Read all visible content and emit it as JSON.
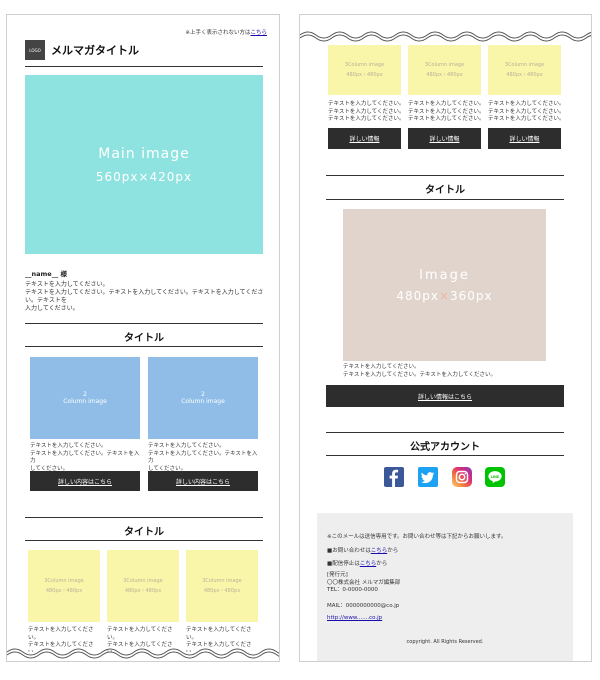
{
  "header": {
    "preheader_text": "※上手く表示されない方は",
    "preheader_link": "こちら",
    "logo": "LOGO",
    "title": "メルマガタイトル"
  },
  "main_image": {
    "label": "Main image",
    "size": "560px × 420px",
    "size_num1": "560px",
    "size_x": "×",
    "size_num2": "420px",
    "color": "#8ee3e0"
  },
  "greeting": {
    "name": "__name__ 様"
  },
  "intro_lines": [
    "テキストを入力してください。",
    "テキストを入力してください。テキストを入力してください。テキストを入力してください。テキストを",
    "入力してください。"
  ],
  "section2": {
    "title": "タイトル",
    "cards": [
      {
        "img_line1": "2",
        "img_line2": "Column image",
        "text": [
          "テキストを入力してください。",
          "テキストを入力してください。テキストを入力",
          "してください。"
        ],
        "button": "詳しい内容はこちら"
      },
      {
        "img_line1": "2",
        "img_line2": "Column image",
        "text": [
          "テキストを入力してください。",
          "テキストを入力してください。テキストを入力",
          "してください。"
        ],
        "button": "詳しい内容はこちら"
      }
    ],
    "color": "#8fbde7"
  },
  "section3": {
    "title": "タイトル",
    "cards": [
      {
        "img_line1": "3Column image",
        "img_line2": "480px・480px",
        "text": [
          "テキストを入力してください。",
          "テキストを入力してください。"
        ]
      },
      {
        "img_line1": "3Column image",
        "img_line2": "480px・480px",
        "text": [
          "テキストを入力してください。",
          "テキストを入力してください。"
        ]
      },
      {
        "img_line1": "3Column image",
        "img_line2": "480px・480px",
        "text": [
          "テキストを入力してください。",
          "テキストを入力してください。"
        ]
      }
    ]
  },
  "right_three_col": {
    "cards": [
      {
        "img_line1": "3Column image",
        "img_line2": "480px・480px",
        "text": [
          "テキストを入力してください。",
          "テキストを入力してください。",
          "テキストを入力してください。"
        ],
        "button": "詳しい情報"
      },
      {
        "img_line1": "3Column image",
        "img_line2": "480px・480px",
        "text": [
          "テキストを入力してください。",
          "テキストを入力してください。",
          "テキストを入力してください。"
        ],
        "button": "詳しい情報"
      },
      {
        "img_line1": "3Column image",
        "img_line2": "480px・480px",
        "text": [
          "テキストを入力してください。",
          "テキストを入力してください。",
          "テキストを入力してください。"
        ],
        "button": "詳しい情報"
      }
    ]
  },
  "section4": {
    "title": "タイトル",
    "image_label": "Image",
    "image_size1": "480px",
    "image_x": "×",
    "image_size2": "360px",
    "image_color": "#e0d4cc",
    "text": [
      "テキストを入力してください。",
      "テキストを入力してください。テキストを入力してください。"
    ],
    "button": "詳しい情報はこちら"
  },
  "social": {
    "title": "公式アカウント",
    "icons": [
      "facebook-icon",
      "twitter-icon",
      "instagram-icon",
      "line-icon"
    ],
    "line_text": "LINE"
  },
  "footer": {
    "note": "※このメールは送信専用です。お問い合わせ等は下記からお願いします。",
    "contact_prefix": "■お問い合わせは",
    "contact_link": "こちら",
    "contact_suffix": "から",
    "unsub_prefix": "■配信停止は",
    "unsub_link": "こちら",
    "unsub_suffix": "から",
    "issuer_label": "[発行元]",
    "company": "〇〇株式会社 メルマガ編集部",
    "tel": "TEL：0-0000-0000",
    "mail": "MAIL：0000000000@co.jp",
    "url": "http://www.......co.jp",
    "copyright": "copyright. All Rights Reserved."
  }
}
